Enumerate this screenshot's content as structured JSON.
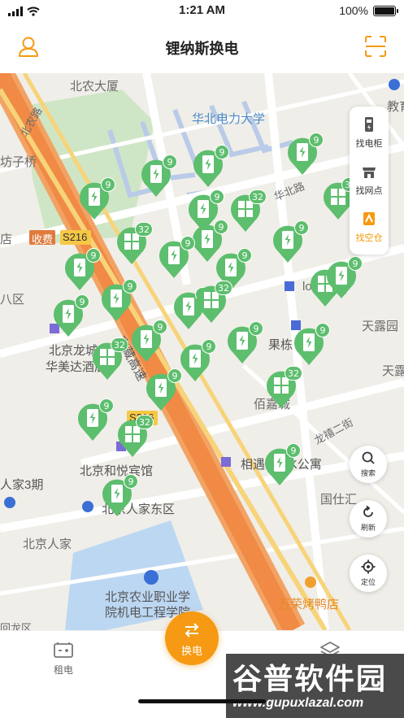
{
  "status_bar": {
    "time": "1:21 AM",
    "battery": "100%"
  },
  "header": {
    "title": "锂纳斯换电"
  },
  "map": {
    "labels": [
      "北农大厦",
      "华北电力大学",
      "北农路",
      "华北路",
      "收费",
      "S216",
      "北京龙城",
      "华美达酒店",
      "京藏高速",
      "果栋",
      "佰嘉城",
      "天露园",
      "天露",
      "龙禧二街",
      "S216",
      "北京和悦宾馆",
      "相遇PARK公寓",
      "人家3期",
      "北京人家东区",
      "北京人家",
      "国仕汇",
      "北京农业职业学",
      "院机电工程学院",
      "万荣烤鸭店",
      "回龙区",
      "八区",
      "店",
      "坊子桥",
      "教育",
      "厦",
      "lo"
    ],
    "pins": [
      {
        "badge": "9"
      },
      {
        "badge": "9"
      },
      {
        "badge": "9"
      },
      {
        "badge": "9"
      },
      {
        "badge": "32"
      },
      {
        "badge": "9"
      },
      {
        "badge": "32"
      },
      {
        "badge": "9"
      },
      {
        "badge": "32"
      },
      {
        "badge": "9"
      },
      {
        "badge": "9"
      },
      {
        "badge": "9"
      },
      {
        "badge": "9"
      },
      {
        "badge": "9"
      },
      {
        "badge": "32"
      },
      {
        "badge": "9"
      },
      {
        "badge": "32"
      },
      {
        "badge": "9"
      },
      {
        "badge": "9"
      },
      {
        "badge": "9"
      },
      {
        "badge": "9"
      },
      {
        "badge": "32"
      },
      {
        "badge": "9"
      },
      {
        "badge": "9"
      },
      {
        "badge": "9"
      },
      {
        "badge": "32"
      },
      {
        "badge": "9"
      },
      {
        "badge": "32"
      },
      {
        "badge": "9"
      },
      {
        "badge": "9"
      }
    ]
  },
  "side_panel": {
    "items": [
      {
        "label": "找电柜",
        "icon": "cabinet-icon"
      },
      {
        "label": "找网点",
        "icon": "store-icon"
      },
      {
        "label": "找空仓",
        "icon": "empty-slot-icon"
      }
    ]
  },
  "map_controls": {
    "search": "搜索",
    "refresh": "刷新",
    "locate": "定位"
  },
  "tabbar": {
    "rent": "租电",
    "swap": "换电"
  },
  "watermark": {
    "line1": "谷普软件园",
    "line2": "www.gupuxlazal.com"
  },
  "colors": {
    "accent": "#f59a12",
    "pin": "#5dbe6e"
  }
}
